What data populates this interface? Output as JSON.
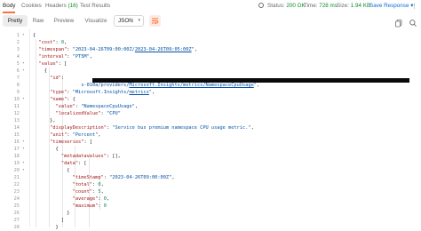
{
  "tabs": [
    {
      "label": "Body",
      "count": "",
      "active": true
    },
    {
      "label": "Cookies",
      "count": "",
      "active": false
    },
    {
      "label": "Headers ",
      "count": "(16)",
      "active": false
    },
    {
      "label": "Test Results",
      "count": "",
      "active": false
    }
  ],
  "status": {
    "status_label": "Status:",
    "status_value": "200 OK",
    "time_label": "Time:",
    "time_value": "728 ms",
    "size_label": "Size:",
    "size_value": "1.94 KB"
  },
  "save_label": "Save Response",
  "save_chevron": "▾",
  "kebab": "⋮",
  "view_modes": [
    "Pretty",
    "Raw",
    "Preview",
    "Visualize"
  ],
  "format": {
    "value": "JSON",
    "chevron": "▾"
  },
  "icons": {
    "wrap": "wrap-lines-icon",
    "copy": "copy-icon",
    "search": "search-icon"
  },
  "lines": [
    {
      "n": "1",
      "fold": "",
      "tokens": [
        {
          "t": "{",
          "c": "p"
        }
      ]
    },
    {
      "n": "2",
      "fold": "",
      "tokens": [
        {
          "t": "  ",
          "c": "p"
        },
        {
          "t": "\"cost\"",
          "c": "k"
        },
        {
          "t": ": ",
          "c": "p"
        },
        {
          "t": "0",
          "c": "n"
        },
        {
          "t": ",",
          "c": "p"
        }
      ]
    },
    {
      "n": "3",
      "fold": "",
      "tokens": [
        {
          "t": "  ",
          "c": "p"
        },
        {
          "t": "\"timespan\"",
          "c": "k"
        },
        {
          "t": ": ",
          "c": "p"
        },
        {
          "t": "\"2023-04-26T09:00:00Z/",
          "c": "s"
        },
        {
          "t": "2023-04-26T09:05:00Z",
          "c": "s u"
        },
        {
          "t": "\"",
          "c": "s"
        },
        {
          "t": ",",
          "c": "p"
        }
      ]
    },
    {
      "n": "4",
      "fold": "",
      "tokens": [
        {
          "t": "  ",
          "c": "p"
        },
        {
          "t": "\"interval\"",
          "c": "k"
        },
        {
          "t": ": ",
          "c": "p"
        },
        {
          "t": "\"PT5M\"",
          "c": "s"
        },
        {
          "t": ",",
          "c": "p"
        }
      ]
    },
    {
      "n": "5",
      "fold": "",
      "tokens": [
        {
          "t": "  ",
          "c": "p"
        },
        {
          "t": "\"value\"",
          "c": "k"
        },
        {
          "t": ": [",
          "c": "p"
        }
      ]
    },
    {
      "n": "6",
      "fold": "",
      "tokens": [
        {
          "t": "    {",
          "c": "p"
        }
      ]
    },
    {
      "n": "7",
      "fold": "",
      "tokens": [
        {
          "t": "      ",
          "c": "p"
        },
        {
          "t": "\"id\"",
          "c": "k"
        },
        {
          "t": ": ",
          "c": "p"
        }
      ]
    },
    {
      "n": "8",
      "fold": "",
      "tokens": [
        {
          "t": "                 ",
          "c": "p"
        },
        {
          "t": "s-010a/providers/",
          "c": "s"
        },
        {
          "t": "Microsoft.Insights/metrics/NamespaceCpuUsage",
          "c": "s u"
        },
        {
          "t": "\",",
          "c": "s"
        }
      ]
    },
    {
      "n": "9",
      "fold": "",
      "tokens": [
        {
          "t": "      ",
          "c": "p"
        },
        {
          "t": "\"type\"",
          "c": "k"
        },
        {
          "t": ": ",
          "c": "p"
        },
        {
          "t": "\"Microsoft.Insights/",
          "c": "s"
        },
        {
          "t": "metrics",
          "c": "s u"
        },
        {
          "t": "\"",
          "c": "s"
        },
        {
          "t": ",",
          "c": "p"
        }
      ]
    },
    {
      "n": "10",
      "fold": "",
      "tokens": [
        {
          "t": "      ",
          "c": "p"
        },
        {
          "t": "\"name\"",
          "c": "k"
        },
        {
          "t": ": {",
          "c": "p"
        }
      ]
    },
    {
      "n": "11",
      "fold": "",
      "tokens": [
        {
          "t": "        ",
          "c": "p"
        },
        {
          "t": "\"value\"",
          "c": "k"
        },
        {
          "t": ": ",
          "c": "p"
        },
        {
          "t": "\"NamespaceCpuUsage\"",
          "c": "s"
        },
        {
          "t": ",",
          "c": "p"
        }
      ]
    },
    {
      "n": "12",
      "fold": "",
      "tokens": [
        {
          "t": "        ",
          "c": "p"
        },
        {
          "t": "\"localizedValue\"",
          "c": "k"
        },
        {
          "t": ": ",
          "c": "p"
        },
        {
          "t": "\"CPU\"",
          "c": "s"
        }
      ]
    },
    {
      "n": "13",
      "fold": "",
      "tokens": [
        {
          "t": "      },",
          "c": "p"
        }
      ]
    },
    {
      "n": "14",
      "fold": "",
      "tokens": [
        {
          "t": "      ",
          "c": "p"
        },
        {
          "t": "\"displayDescription\"",
          "c": "k"
        },
        {
          "t": ": ",
          "c": "p"
        },
        {
          "t": "\"Service bus premium namespace CPU usage metric.\"",
          "c": "s"
        },
        {
          "t": ",",
          "c": "p"
        }
      ]
    },
    {
      "n": "15",
      "fold": "",
      "tokens": [
        {
          "t": "      ",
          "c": "p"
        },
        {
          "t": "\"unit\"",
          "c": "k"
        },
        {
          "t": ": ",
          "c": "p"
        },
        {
          "t": "\"Percent\"",
          "c": "s"
        },
        {
          "t": ",",
          "c": "p"
        }
      ]
    },
    {
      "n": "16",
      "fold": "",
      "tokens": [
        {
          "t": "      ",
          "c": "p"
        },
        {
          "t": "\"timeseries\"",
          "c": "k"
        },
        {
          "t": ": [",
          "c": "p"
        }
      ]
    },
    {
      "n": "17",
      "fold": "",
      "tokens": [
        {
          "t": "        {",
          "c": "p"
        }
      ]
    },
    {
      "n": "18",
      "fold": "",
      "tokens": [
        {
          "t": "          ",
          "c": "p"
        },
        {
          "t": "\"metadatavalues\"",
          "c": "k"
        },
        {
          "t": ": [],",
          "c": "p"
        }
      ]
    },
    {
      "n": "19",
      "fold": "",
      "tokens": [
        {
          "t": "          ",
          "c": "p"
        },
        {
          "t": "\"data\"",
          "c": "k"
        },
        {
          "t": ": [",
          "c": "p"
        }
      ]
    },
    {
      "n": "20",
      "fold": "",
      "tokens": [
        {
          "t": "            {",
          "c": "p"
        }
      ]
    },
    {
      "n": "21",
      "fold": "",
      "tokens": [
        {
          "t": "              ",
          "c": "p"
        },
        {
          "t": "\"timeStamp\"",
          "c": "k"
        },
        {
          "t": ": ",
          "c": "p"
        },
        {
          "t": "\"2023-04-26T09:00:00Z\"",
          "c": "s"
        },
        {
          "t": ",",
          "c": "p"
        }
      ]
    },
    {
      "n": "22",
      "fold": "",
      "tokens": [
        {
          "t": "              ",
          "c": "p"
        },
        {
          "t": "\"total\"",
          "c": "k"
        },
        {
          "t": ": ",
          "c": "p"
        },
        {
          "t": "0",
          "c": "n"
        },
        {
          "t": ",",
          "c": "p"
        }
      ]
    },
    {
      "n": "23",
      "fold": "",
      "tokens": [
        {
          "t": "              ",
          "c": "p"
        },
        {
          "t": "\"count\"",
          "c": "k"
        },
        {
          "t": ": ",
          "c": "p"
        },
        {
          "t": "5",
          "c": "n"
        },
        {
          "t": ",",
          "c": "p"
        }
      ]
    },
    {
      "n": "24",
      "fold": "",
      "tokens": [
        {
          "t": "              ",
          "c": "p"
        },
        {
          "t": "\"average\"",
          "c": "k"
        },
        {
          "t": ": ",
          "c": "p"
        },
        {
          "t": "0",
          "c": "n"
        },
        {
          "t": ",",
          "c": "p"
        }
      ]
    },
    {
      "n": "25",
      "fold": "",
      "tokens": [
        {
          "t": "              ",
          "c": "p"
        },
        {
          "t": "\"maximum\"",
          "c": "k"
        },
        {
          "t": ": ",
          "c": "p"
        },
        {
          "t": "0",
          "c": "n"
        }
      ]
    },
    {
      "n": "26",
      "fold": "",
      "tokens": [
        {
          "t": "            }",
          "c": "p"
        }
      ]
    },
    {
      "n": "27",
      "fold": "",
      "tokens": [
        {
          "t": "          ]",
          "c": "p"
        }
      ]
    },
    {
      "n": "28",
      "fold": "",
      "tokens": [
        {
          "t": "        }",
          "c": "p"
        }
      ]
    }
  ]
}
